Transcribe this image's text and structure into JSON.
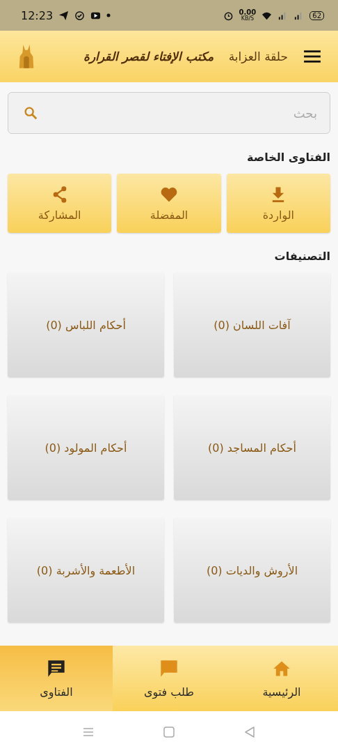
{
  "status_bar": {
    "time": "12:23",
    "speed": "0.00",
    "speed_unit": "KB/S",
    "battery": "62"
  },
  "header": {
    "title": "مكتب الإفتاء لقصر القرارة",
    "subtitle": "حلقة العزابة"
  },
  "search": {
    "placeholder": "بحث"
  },
  "private_fatwas": {
    "title": "الفتاوى الخاصة",
    "buttons": [
      {
        "kind": "download",
        "label": "الواردة"
      },
      {
        "kind": "heart",
        "label": "المفضلة"
      },
      {
        "kind": "share",
        "label": "المشاركة"
      }
    ]
  },
  "categories": {
    "title": "التصنيفات",
    "items": [
      {
        "label": "آفات اللسان (0)"
      },
      {
        "label": "أحكام اللباس (0)"
      },
      {
        "label": "أحكام المساجد (0)"
      },
      {
        "label": "أحكام المولود (0)"
      },
      {
        "label": "الأروش والديات (0)"
      },
      {
        "label": "الأطعمة والأشربة (0)"
      }
    ]
  },
  "bottom_nav": [
    {
      "kind": "home",
      "label": "الرئيسية",
      "selected": false
    },
    {
      "kind": "chat",
      "label": "طلب فتوى",
      "selected": false
    },
    {
      "kind": "fatwa",
      "label": "الفتاوى",
      "selected": true
    }
  ]
}
